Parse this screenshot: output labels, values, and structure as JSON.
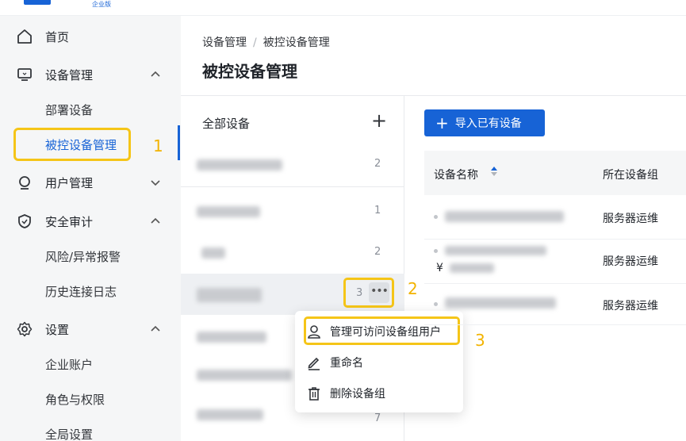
{
  "logo": {
    "subtitle": "企业版"
  },
  "sidebar": {
    "home": "首页",
    "device_mgmt": "设备管理",
    "deploy_device": "部署设备",
    "managed_devices": "被控设备管理",
    "user_mgmt": "用户管理",
    "security_audit": "安全审计",
    "risk_alerts": "风险/异常报警",
    "history_log": "历史连接日志",
    "settings": "设置",
    "enterprise_account": "企业账户",
    "roles": "角色与权限",
    "global_settings": "全局设置"
  },
  "annotations": {
    "step1": "1",
    "step2": "2",
    "step3": "3"
  },
  "breadcrumb": {
    "parent": "设备管理",
    "separator": "/",
    "current": "被控设备管理"
  },
  "page_title": "被控设备管理",
  "groups": {
    "all_label": "全部设备",
    "add_symbol": "+",
    "counts": [
      "2",
      "1",
      "2",
      "3",
      "7"
    ],
    "more_symbol": "•••"
  },
  "menu": {
    "manage_users": "管理可访问设备组用户",
    "rename": "重命名",
    "delete_group": "删除设备组"
  },
  "toolbar": {
    "import_plus": "+",
    "import_label": "导入已有设备"
  },
  "table": {
    "col_name": "设备名称",
    "col_group": "所在设备组",
    "rows": [
      {
        "group": "服务器运维"
      },
      {
        "group": "服务器运维",
        "prefix": "¥"
      },
      {
        "group": "服务器运维"
      }
    ]
  },
  "colors": {
    "accent": "#1763d6",
    "highlight": "#f5c518"
  }
}
